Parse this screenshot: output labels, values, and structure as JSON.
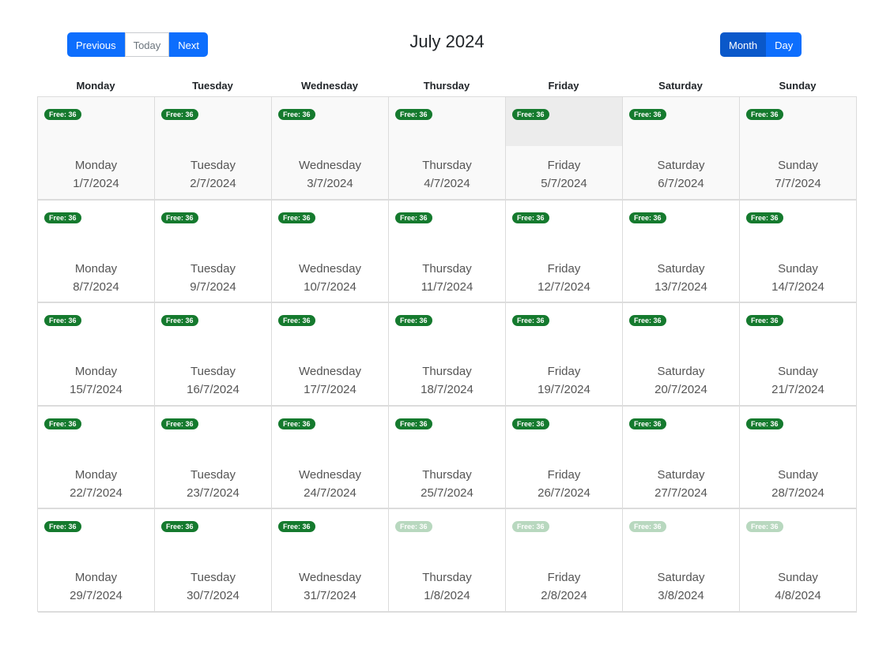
{
  "toolbar": {
    "previous_label": "Previous",
    "today_label": "Today",
    "next_label": "Next",
    "title": "July 2024",
    "month_label": "Month",
    "day_label": "Day"
  },
  "weekdays": [
    "Monday",
    "Tuesday",
    "Wednesday",
    "Thursday",
    "Friday",
    "Saturday",
    "Sunday"
  ],
  "colors": {
    "primary": "#0d6efd",
    "primary_active": "#0a58ca",
    "badge": "#157a2e",
    "badge_other_month": "#b8d8bf",
    "today_highlight": "#ececec"
  },
  "weeks": [
    [
      {
        "badge": "Free: 36",
        "day": "Monday",
        "date": "1/7/2024"
      },
      {
        "badge": "Free: 36",
        "day": "Tuesday",
        "date": "2/7/2024"
      },
      {
        "badge": "Free: 36",
        "day": "Wednesday",
        "date": "3/7/2024"
      },
      {
        "badge": "Free: 36",
        "day": "Thursday",
        "date": "4/7/2024"
      },
      {
        "badge": "Free: 36",
        "day": "Friday",
        "date": "5/7/2024",
        "today": true
      },
      {
        "badge": "Free: 36",
        "day": "Saturday",
        "date": "6/7/2024"
      },
      {
        "badge": "Free: 36",
        "day": "Sunday",
        "date": "7/7/2024"
      }
    ],
    [
      {
        "badge": "Free: 36",
        "day": "Monday",
        "date": "8/7/2024"
      },
      {
        "badge": "Free: 36",
        "day": "Tuesday",
        "date": "9/7/2024"
      },
      {
        "badge": "Free: 36",
        "day": "Wednesday",
        "date": "10/7/2024"
      },
      {
        "badge": "Free: 36",
        "day": "Thursday",
        "date": "11/7/2024"
      },
      {
        "badge": "Free: 36",
        "day": "Friday",
        "date": "12/7/2024"
      },
      {
        "badge": "Free: 36",
        "day": "Saturday",
        "date": "13/7/2024"
      },
      {
        "badge": "Free: 36",
        "day": "Sunday",
        "date": "14/7/2024"
      }
    ],
    [
      {
        "badge": "Free: 36",
        "day": "Monday",
        "date": "15/7/2024"
      },
      {
        "badge": "Free: 36",
        "day": "Tuesday",
        "date": "16/7/2024"
      },
      {
        "badge": "Free: 36",
        "day": "Wednesday",
        "date": "17/7/2024"
      },
      {
        "badge": "Free: 36",
        "day": "Thursday",
        "date": "18/7/2024"
      },
      {
        "badge": "Free: 36",
        "day": "Friday",
        "date": "19/7/2024"
      },
      {
        "badge": "Free: 36",
        "day": "Saturday",
        "date": "20/7/2024"
      },
      {
        "badge": "Free: 36",
        "day": "Sunday",
        "date": "21/7/2024"
      }
    ],
    [
      {
        "badge": "Free: 36",
        "day": "Monday",
        "date": "22/7/2024"
      },
      {
        "badge": "Free: 36",
        "day": "Tuesday",
        "date": "23/7/2024"
      },
      {
        "badge": "Free: 36",
        "day": "Wednesday",
        "date": "24/7/2024"
      },
      {
        "badge": "Free: 36",
        "day": "Thursday",
        "date": "25/7/2024"
      },
      {
        "badge": "Free: 36",
        "day": "Friday",
        "date": "26/7/2024"
      },
      {
        "badge": "Free: 36",
        "day": "Saturday",
        "date": "27/7/2024"
      },
      {
        "badge": "Free: 36",
        "day": "Sunday",
        "date": "28/7/2024"
      }
    ],
    [
      {
        "badge": "Free: 36",
        "day": "Monday",
        "date": "29/7/2024"
      },
      {
        "badge": "Free: 36",
        "day": "Tuesday",
        "date": "30/7/2024"
      },
      {
        "badge": "Free: 36",
        "day": "Wednesday",
        "date": "31/7/2024"
      },
      {
        "badge": "Free: 36",
        "day": "Thursday",
        "date": "1/8/2024",
        "other_month": true
      },
      {
        "badge": "Free: 36",
        "day": "Friday",
        "date": "2/8/2024",
        "other_month": true
      },
      {
        "badge": "Free: 36",
        "day": "Saturday",
        "date": "3/8/2024",
        "other_month": true
      },
      {
        "badge": "Free: 36",
        "day": "Sunday",
        "date": "4/8/2024",
        "other_month": true
      }
    ]
  ]
}
